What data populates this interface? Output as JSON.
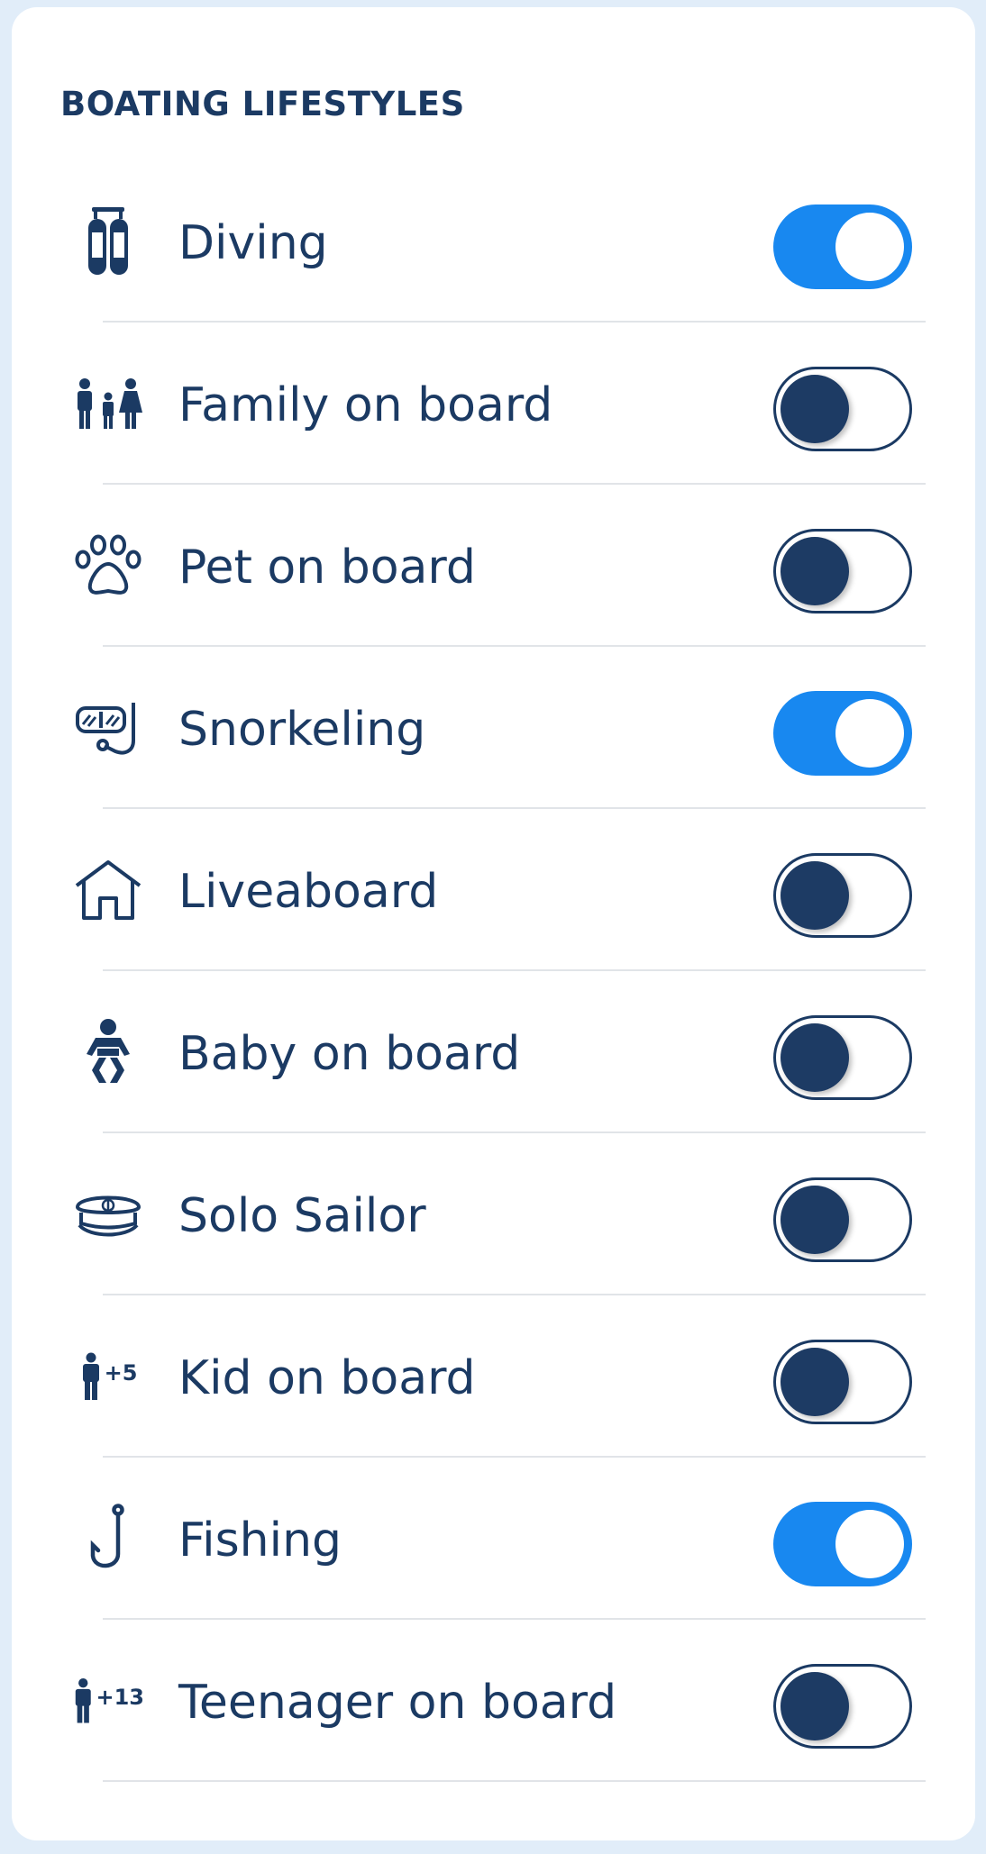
{
  "title": "BOATING LIFESTYLES",
  "colors": {
    "accent": "#1888f0",
    "navy": "#1b3a63",
    "background": "#e1edf9"
  },
  "items": [
    {
      "label": "Diving",
      "icon": "scuba-tanks-icon",
      "enabled": true
    },
    {
      "label": "Family on board",
      "icon": "family-icon",
      "enabled": false
    },
    {
      "label": "Pet on board",
      "icon": "paw-icon",
      "enabled": false
    },
    {
      "label": "Snorkeling",
      "icon": "snorkel-mask-icon",
      "enabled": true
    },
    {
      "label": "Liveaboard",
      "icon": "house-icon",
      "enabled": false
    },
    {
      "label": "Baby on board",
      "icon": "baby-icon",
      "enabled": false
    },
    {
      "label": "Solo Sailor",
      "icon": "captain-hat-icon",
      "enabled": false
    },
    {
      "label": "Kid on board",
      "icon": "kid-icon",
      "badge": "+5",
      "enabled": false
    },
    {
      "label": "Fishing",
      "icon": "fishing-hook-icon",
      "enabled": true
    },
    {
      "label": "Teenager on board",
      "icon": "teenager-icon",
      "badge": "+13",
      "enabled": false
    }
  ]
}
